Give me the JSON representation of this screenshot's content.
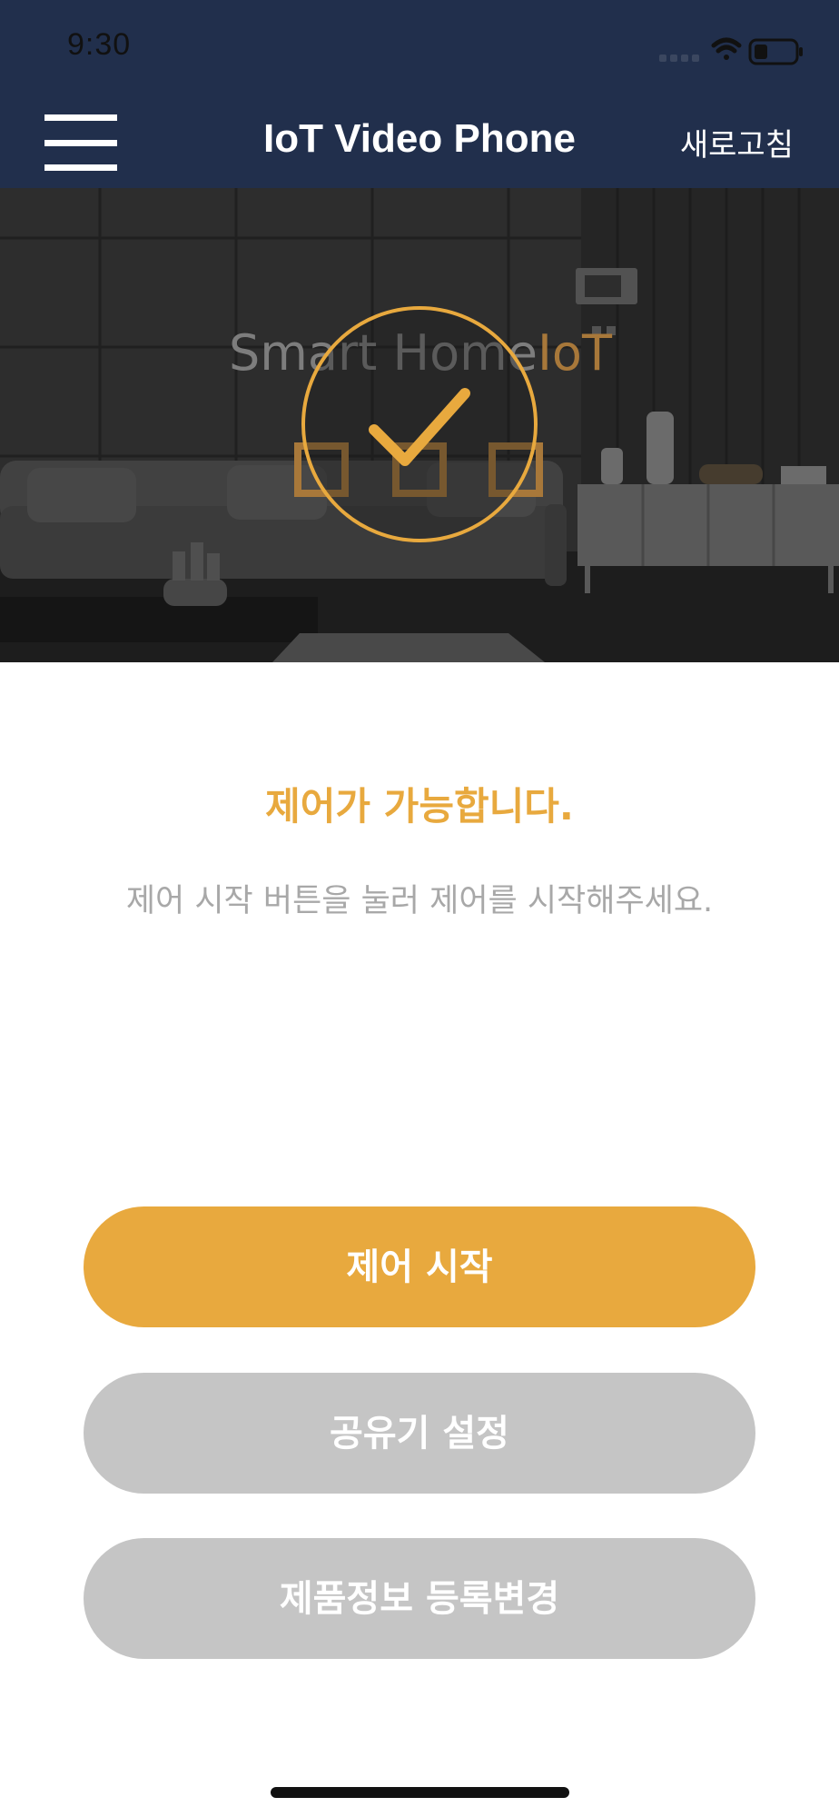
{
  "status_bar": {
    "time": "9:30",
    "icons": [
      "signal-icon",
      "wifi-icon",
      "battery-icon"
    ]
  },
  "header": {
    "menu_icon": "hamburger-menu-icon",
    "title": "IoT Video Phone",
    "refresh_label": "새로고침"
  },
  "hero": {
    "brand_text_main": "Smart Home",
    "brand_text_accent": "IoT",
    "status_icon": "check-circle-icon"
  },
  "status": {
    "heading": "제어가 가능합니다.",
    "description": "제어 시작 버튼을 눌러 제어를 시작해주세요."
  },
  "buttons": {
    "start_control": "제어 시작",
    "router_setup": "공유기 설정",
    "product_info": "제품정보 등록변경"
  },
  "colors": {
    "header_bg": "#212f4c",
    "accent": "#e8a93e",
    "button_disabled": "#c5c5c5",
    "description_text": "#a8a8a8"
  }
}
